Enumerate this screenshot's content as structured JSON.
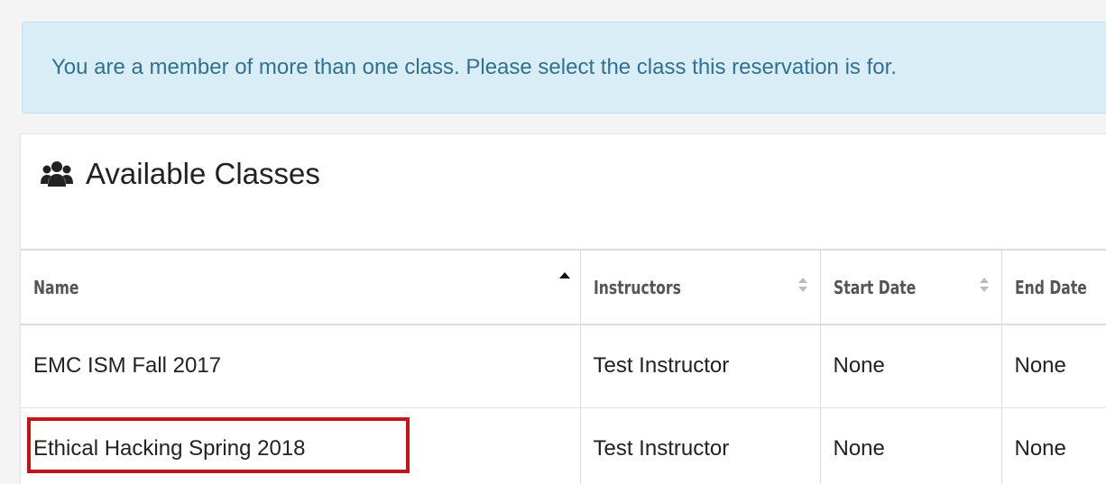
{
  "alert": {
    "message": "You are a member of more than one class. Please select the class this reservation is for."
  },
  "panel": {
    "title": "Available Classes",
    "icon": "users-icon"
  },
  "table": {
    "columns": [
      {
        "label": "Name",
        "sort": "ascending"
      },
      {
        "label": "Instructors",
        "sort": "sortable"
      },
      {
        "label": "Start Date",
        "sort": "sortable"
      },
      {
        "label": "End Date",
        "sort": "sortable"
      }
    ],
    "rows": [
      {
        "name": "EMC ISM Fall 2017",
        "instructors": "Test Instructor",
        "start_date": "None",
        "end_date": "None"
      },
      {
        "name": "Ethical Hacking Spring 2018",
        "instructors": "Test Instructor",
        "start_date": "None",
        "end_date": "None"
      }
    ]
  },
  "colors": {
    "alert_bg": "#d9edf7",
    "alert_text": "#31708f",
    "highlight_border": "#c0151b"
  }
}
